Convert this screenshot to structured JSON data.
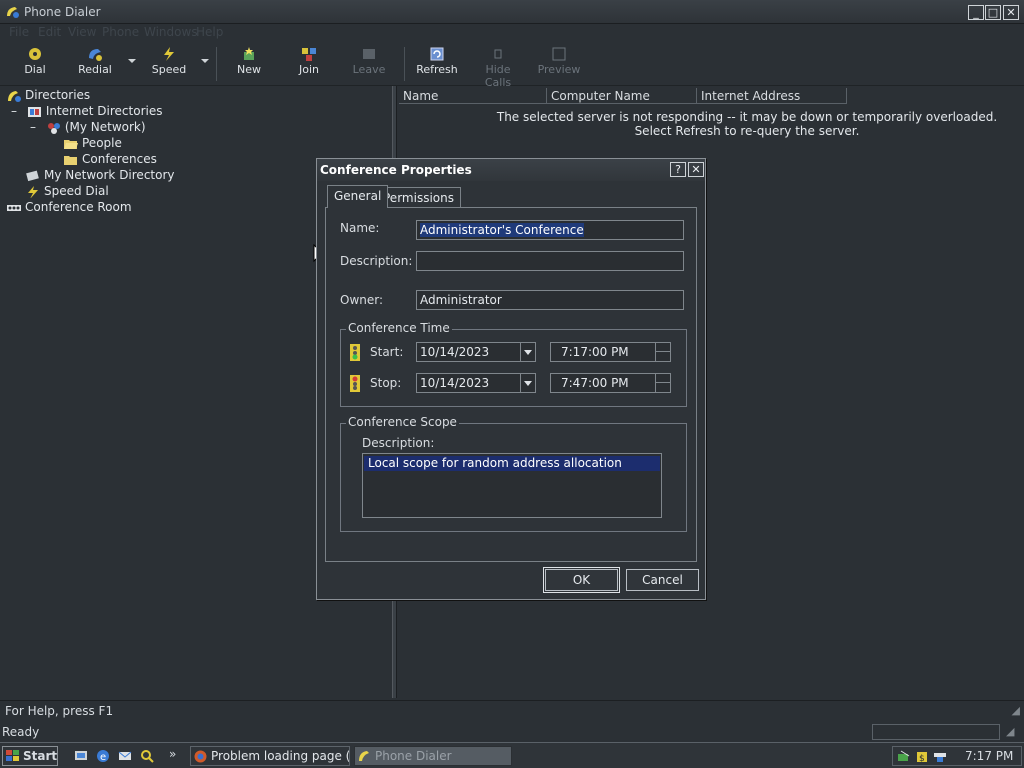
{
  "window": {
    "title": "Phone Dialer"
  },
  "menu": [
    "File",
    "Edit",
    "View",
    "Phone",
    "Windows",
    "Help"
  ],
  "toolbar": {
    "dial": "Dial",
    "redial": "Redial",
    "speed": "Speed",
    "new": "New",
    "join": "Join",
    "leave": "Leave",
    "refresh": "Refresh",
    "hide_calls": "Hide Calls",
    "preview": "Preview"
  },
  "tree": {
    "directories": "Directories",
    "internet_directories": "Internet Directories",
    "my_network": "(My Network)",
    "people": "People",
    "conferences": "Conferences",
    "my_network_directory": "My Network Directory",
    "speed_dial": "Speed Dial",
    "conference_room": "Conference Room"
  },
  "list": {
    "columns": [
      "Name",
      "Computer Name",
      "Internet Address"
    ],
    "message_line1": "The selected server is not responding -- it may be down or temporarily overloaded.",
    "message_line2": "Select Refresh to re-query the server."
  },
  "dialog": {
    "title": "Conference Properties",
    "help_btn": "?",
    "close_btn": "✕",
    "tabs": [
      "General",
      "Permissions"
    ],
    "name_label": "Name:",
    "name_value": "Administrator's Conference",
    "description_label": "Description:",
    "description_value": "",
    "owner_label": "Owner:",
    "owner_value": "Administrator",
    "time_group": "Conference Time",
    "start_label": "Start:",
    "start_date": "10/14/2023",
    "start_time": "7:17:00 PM",
    "stop_label": "Stop:",
    "stop_date": "10/14/2023",
    "stop_time": "7:47:00 PM",
    "scope_group": "Conference Scope",
    "scope_description_label": "Description:",
    "scope_items": [
      "Local scope for random address allocation"
    ],
    "ok": "OK",
    "cancel": "Cancel"
  },
  "status": {
    "help": "For Help, press F1",
    "ready": "Ready"
  },
  "taskbar": {
    "start": "Start",
    "task1": "Problem loading page (K-...",
    "task2": "Phone Dialer",
    "clock": "7:17 PM",
    "quicklaunch_more": "»"
  },
  "colors": {
    "window_bg": "#2b3035",
    "selection": "#1c2d6e",
    "text": "#d8dde2"
  }
}
